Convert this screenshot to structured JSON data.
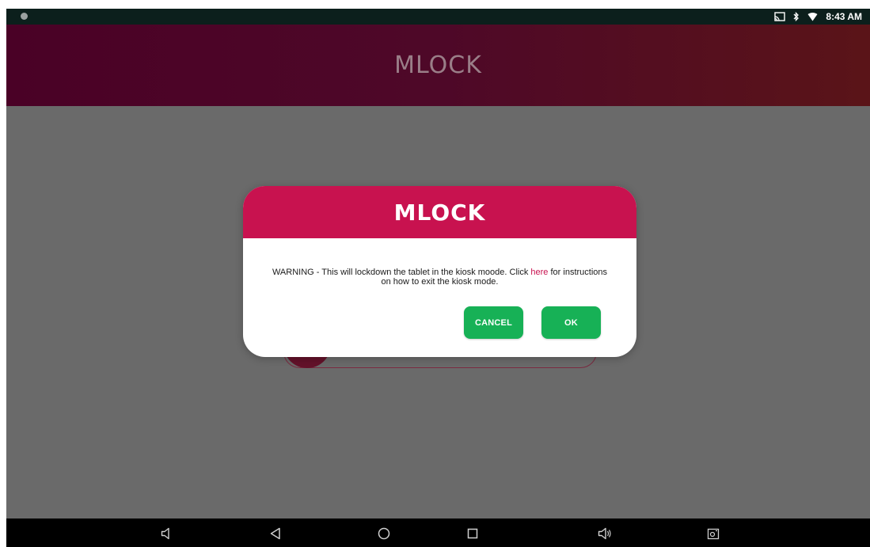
{
  "status_bar": {
    "time": "8:43 AM",
    "icons": [
      "notification-dot-icon",
      "cast-icon",
      "bluetooth-icon",
      "wifi-icon"
    ]
  },
  "header": {
    "title": "MLOCK",
    "gradient_colors": [
      "#4a0126",
      "#5a1418"
    ]
  },
  "dialog": {
    "title": "MLOCK",
    "message_before_link": "WARNING - This will lockdown the tablet in the kiosk moode. Click ",
    "link_text": "here",
    "message_after_link": " for instructions on how to exit the kiosk mode.",
    "cancel_label": "CANCEL",
    "ok_label": "OK",
    "header_color": "#c8124f",
    "button_color": "#17b156"
  },
  "nav_bar": {
    "buttons": [
      "volume-down-icon",
      "back-icon",
      "home-icon",
      "recents-icon",
      "volume-up-icon",
      "screenshot-icon"
    ]
  }
}
